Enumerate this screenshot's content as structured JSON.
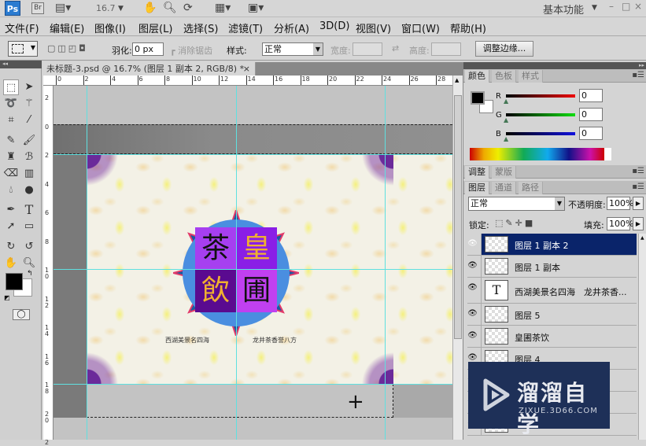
{
  "appbar": {
    "ps": "Ps",
    "br": "Br",
    "zoom": "16.7",
    "workspace": "基本功能"
  },
  "menu": [
    "文件(F)",
    "编辑(E)",
    "图像(I)",
    "图层(L)",
    "选择(S)",
    "滤镜(T)",
    "分析(A)",
    "3D(D)",
    "视图(V)",
    "窗口(W)",
    "帮助(H)"
  ],
  "options": {
    "feather_label": "羽化:",
    "feather_value": "0 px",
    "antialias": "消除锯齿",
    "style_label": "样式:",
    "style_value": "正常",
    "width_label": "宽度:",
    "height_label": "高度:",
    "refine_button": "调整边缘..."
  },
  "document": {
    "tab_title": "未标题-3.psd @ 16.7% (图层 1 副本 2, RGB/8) *",
    "close": "×",
    "hruler": [
      "0",
      "2",
      "4",
      "6",
      "8",
      "10",
      "12",
      "14",
      "16",
      "18",
      "20",
      "22",
      "24",
      "26",
      "28"
    ],
    "vruler": [
      "2",
      "0",
      "2",
      "4",
      "6",
      "8",
      "10",
      "12",
      "14",
      "16",
      "18",
      "20",
      "2"
    ],
    "artwork": {
      "chars": [
        "茶",
        "皇",
        "飲",
        "圃"
      ],
      "line1": "西湖美景名四海",
      "line2": "龙井茶香誉八方"
    }
  },
  "color_panel": {
    "tabs": [
      "颜色",
      "色板",
      "样式"
    ],
    "r_label": "R",
    "g_label": "G",
    "b_label": "B",
    "r": "0",
    "g": "0",
    "b": "0",
    "foreground": "#000000",
    "background": "#ffffff"
  },
  "adjust_panel": {
    "tabs": [
      "调整",
      "蒙版"
    ]
  },
  "layers_panel": {
    "tabs": [
      "图层",
      "通道",
      "路径"
    ],
    "blend_mode": "正常",
    "opacity_label": "不透明度:",
    "opacity": "100%",
    "lock_label": "锁定:",
    "fill_label": "填充:",
    "fill": "100%",
    "layers": [
      {
        "name": "图层 1 副本 2",
        "selected": true
      },
      {
        "name": "图层 1 副本"
      },
      {
        "name": "西湖美景名四海　龙井茶香...",
        "type": "text"
      },
      {
        "name": "图层 5"
      },
      {
        "name": "皇圃茶饮"
      },
      {
        "name": "图层 4"
      }
    ]
  },
  "watermark": {
    "title": "溜溜自学",
    "url": "ZIXUE.3D66.COM"
  }
}
